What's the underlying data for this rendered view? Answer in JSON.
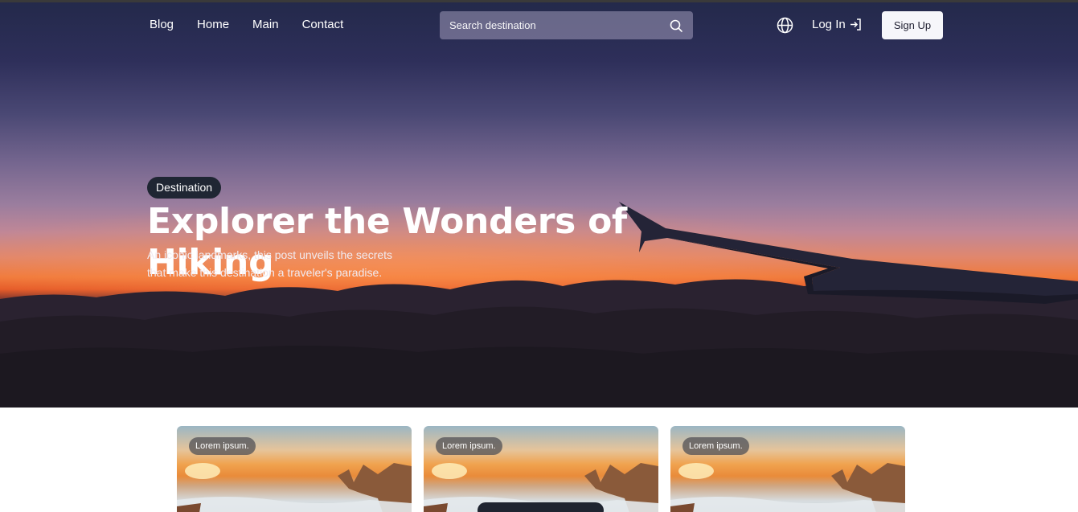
{
  "nav": {
    "links": [
      "Blog",
      "Home",
      "Main",
      "Contact"
    ],
    "search_placeholder": "Search destination",
    "login_label": "Log In",
    "signup_label": "Sign Up"
  },
  "hero": {
    "tag": "Destination",
    "title": "Explorer the Wonders of Hiking",
    "description_line1": "An iconic landmarks, this post unveils the secrets",
    "description_line2": "that make this destination a traveler's paradise."
  },
  "cards": [
    {
      "badge": "Lorem ipsum."
    },
    {
      "badge": "Lorem ipsum."
    },
    {
      "badge": "Lorem ipsum."
    }
  ],
  "colors": {
    "tag_bg": "#1f2633",
    "signup_bg": "#f6f6fa",
    "badge_bg": "#505055"
  }
}
